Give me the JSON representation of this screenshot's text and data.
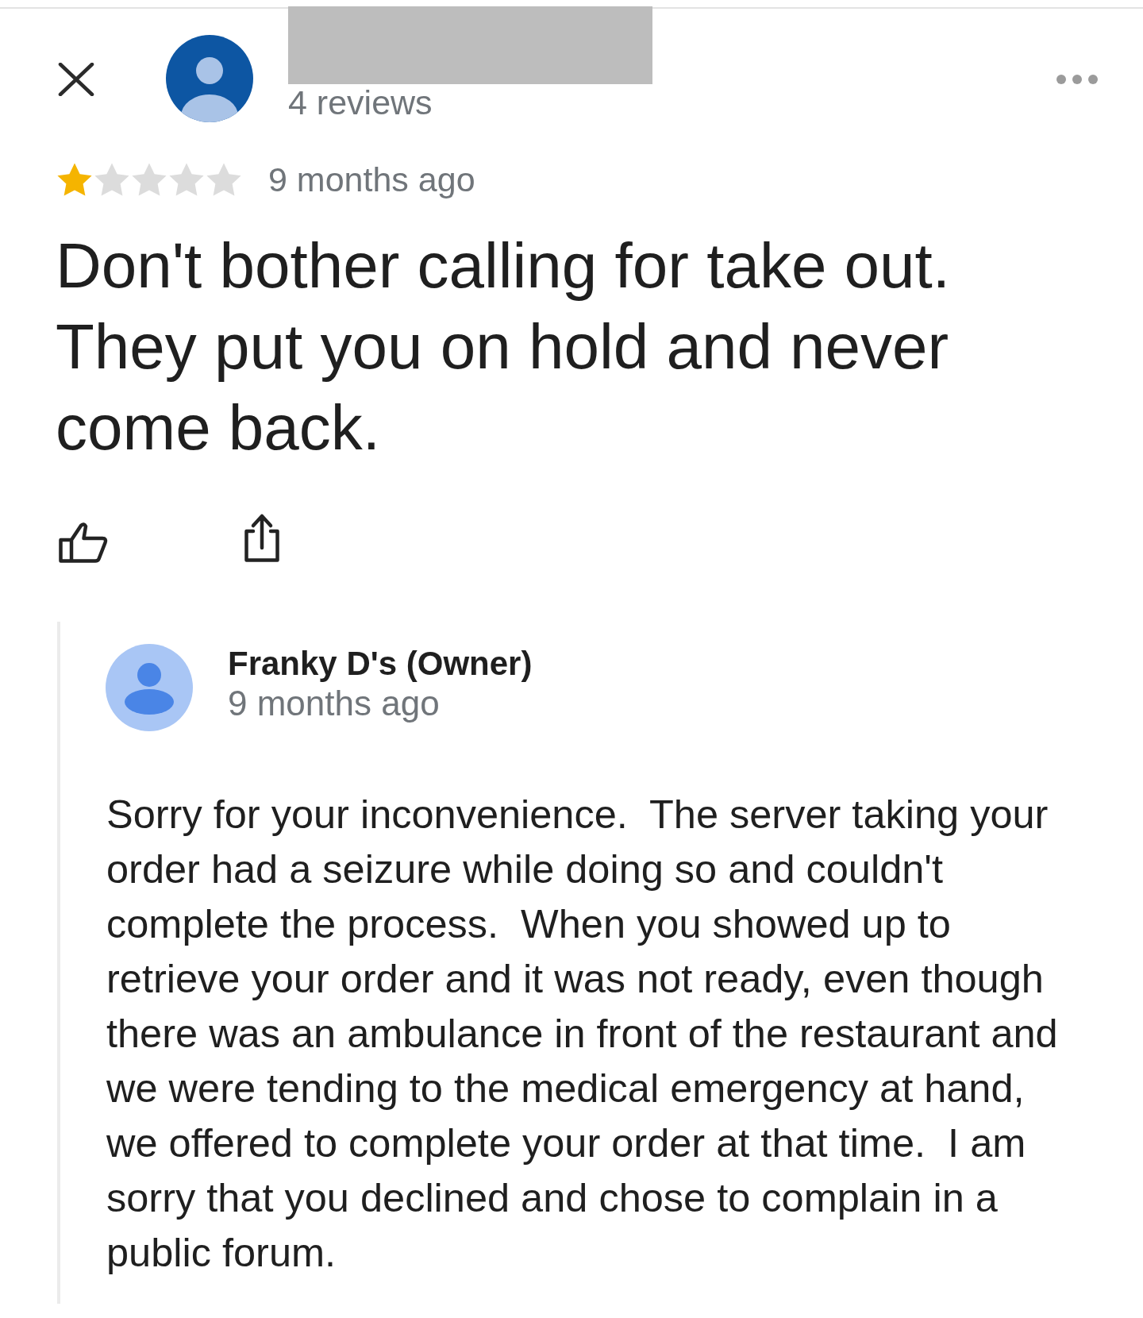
{
  "reviewer": {
    "review_count": "4 reviews"
  },
  "review": {
    "stars": 1,
    "time": "9 months ago",
    "text": "Don't bother calling for take out. They put you on hold and never come back."
  },
  "owner_reply": {
    "name": "Franky D's (Owner)",
    "time": "9 months ago",
    "text": "Sorry for your inconvenience.  The server taking your order had a seizure while doing so and couldn't complete the process.  When you showed up to retrieve your order and it was not ready, even though there was an ambulance in front of the restaurant and we were tending to the medical emergency at hand, we offered to complete your order at that time.  I am sorry that you declined and chose to complain in a public forum."
  }
}
